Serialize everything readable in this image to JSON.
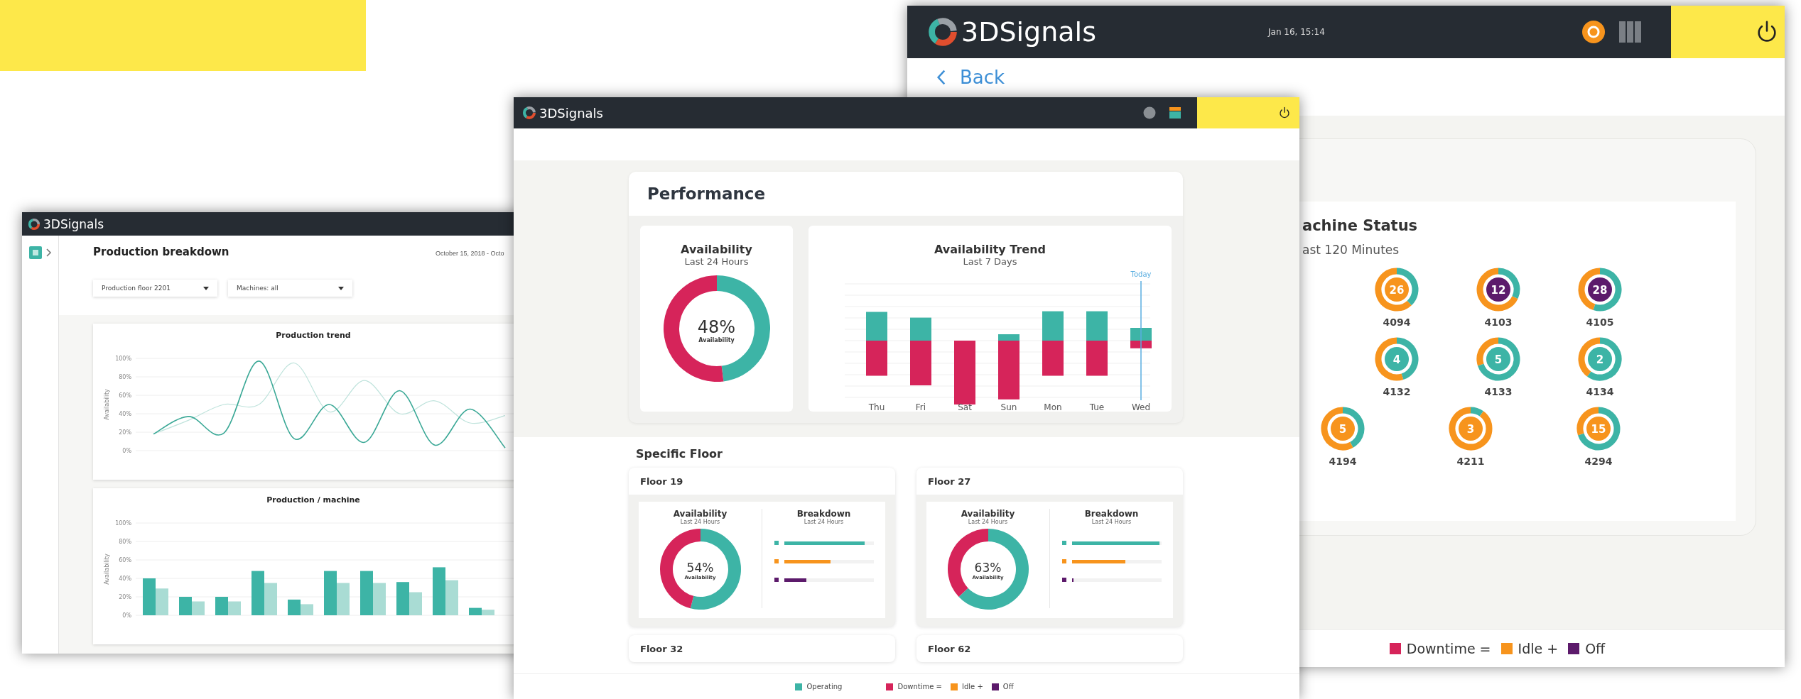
{
  "left_window": {
    "logo": "3DSignals",
    "title": "Production breakdown",
    "date_range": "October 15, 2018 - Octo",
    "dropdowns": [
      {
        "value": "Production floor 2201"
      },
      {
        "value": "Machines: all"
      }
    ],
    "trend_card": {
      "chart_data": {
        "type": "line",
        "title": "Production trend",
        "ylabel": "Availability",
        "grid": true,
        "ylim": [
          0,
          100
        ],
        "yticks": [
          {
            "value": 0,
            "label": "0%"
          },
          {
            "value": 20,
            "label": "20%"
          },
          {
            "value": 40,
            "label": "40%"
          },
          {
            "value": 60,
            "label": "60%"
          },
          {
            "value": 80,
            "label": "80%"
          },
          {
            "value": 100,
            "label": "100%"
          }
        ],
        "series": [
          {
            "color": "#3aa896",
            "values": [
              18,
              37,
              19,
              97,
              13,
              50,
              9,
              65,
              6,
              45,
              3
            ]
          },
          {
            "color": "#bfe3dc",
            "values": [
              18,
              33,
              50,
              50,
              95,
              42,
              76,
              40,
              54,
              30,
              38
            ]
          }
        ]
      }
    },
    "machine_card": {
      "chart_data": {
        "type": "bar",
        "title": "Production / machine",
        "ylabel": "Availability",
        "grid": true,
        "ylim": [
          0,
          100
        ],
        "yticks": [
          {
            "value": 0,
            "label": "0%"
          },
          {
            "value": 20,
            "label": "20%"
          },
          {
            "value": 40,
            "label": "40%"
          },
          {
            "value": 60,
            "label": "60%"
          },
          {
            "value": 80,
            "label": "80%"
          },
          {
            "value": 100,
            "label": "100%"
          }
        ],
        "series": [
          {
            "color": "#3db4a6",
            "values": [
              40,
              20,
              20,
              48,
              17,
              48,
              48,
              36,
              52,
              8
            ]
          },
          {
            "color": "#a9dcd4",
            "values": [
              29,
              15,
              15,
              35,
              12,
              35,
              35,
              25,
              38,
              6
            ]
          }
        ]
      }
    }
  },
  "middle_window": {
    "logo": "3DSignals",
    "performance": {
      "title": "Performance",
      "availability": {
        "title": "Availability",
        "subtitle": "Last 24 Hours",
        "value": "48%",
        "caption": "Availability",
        "chart_data": {
          "type": "donut",
          "values": [
            48,
            52
          ]
        }
      },
      "trend": {
        "title": "Availability Trend",
        "subtitle": "Last 7 Days",
        "today_label": "Today",
        "days": [
          "Thu",
          "Fri",
          "Sat",
          "Sun",
          "Mon",
          "Tue",
          "Wed"
        ]
      }
    },
    "floor_section": {
      "title": "Specific Floor",
      "floors": [
        {
          "name": "Floor 19",
          "availability_title": "Availability",
          "availability_subtitle": "Last 24 Hours",
          "value": "54%",
          "caption": "Availability",
          "chart_data": {
            "type": "donut",
            "values": [
              54,
              46
            ]
          },
          "breakdown_title": "Breakdown",
          "breakdown_subtitle": "Last 24 Hours",
          "bars": [
            {
              "color": "#3db4a6",
              "level": 0.9
            },
            {
              "color": "#f7941d",
              "level": 0.52
            },
            {
              "color": "#5c1a6b",
              "level": 0.25
            }
          ]
        },
        {
          "name": "Floor 27",
          "availability_title": "Availability",
          "availability_subtitle": "Last 24 Hours",
          "value": "63%",
          "caption": "Availability",
          "chart_data": {
            "type": "donut",
            "values": [
              63,
              37
            ]
          },
          "breakdown_title": "Breakdown",
          "breakdown_subtitle": "Last 24 Hours",
          "bars": [
            {
              "color": "#3db4a6",
              "level": 0.98
            },
            {
              "color": "#f7941d",
              "level": 0.6
            },
            {
              "color": "#5c1a6b",
              "level": 0.02
            }
          ]
        }
      ],
      "collapsed_floors": [
        {
          "name": "Floor 32"
        },
        {
          "name": "Floor 62"
        }
      ]
    },
    "legend": [
      {
        "label": "Operating",
        "color": "#3db4a6"
      },
      {
        "label": "Downtime =",
        "color": "#d6245a"
      },
      {
        "label": "Idle +",
        "color": "#f7941d"
      },
      {
        "label": "Off",
        "color": "#5c1a6b"
      }
    ]
  },
  "right_window": {
    "logo": "3DSignals",
    "datetime": "Jan 16, 15:14",
    "back": "Back",
    "status": {
      "title": "achine Status",
      "subtitle": "ast 120 Minutes",
      "rows": [
        [
          {
            "id": "4094",
            "count": "26",
            "color": "#f7941d"
          },
          {
            "id": "4103",
            "count": "12",
            "color": "#5c1a6b"
          },
          {
            "id": "4105",
            "count": "28",
            "color": "#5c1a6b"
          }
        ],
        [
          {
            "id": "4132",
            "count": "4",
            "color": "#3db4a6"
          },
          {
            "id": "4133",
            "count": "5",
            "color": "#3db4a6"
          },
          {
            "id": "4134",
            "count": "2",
            "color": "#3db4a6"
          }
        ],
        [
          {
            "id": "4194",
            "count": "5",
            "color": "#f7941d"
          },
          {
            "id": "4211",
            "count": "3",
            "color": "#f7941d"
          },
          {
            "id": "4294",
            "count": "15",
            "color": "#f7941d"
          }
        ]
      ]
    },
    "legend": [
      {
        "label": "Downtime =",
        "color": "#d6245a"
      },
      {
        "label": "Idle +",
        "color": "#f7941d"
      },
      {
        "label": "Off",
        "color": "#5c1a6b"
      }
    ]
  }
}
